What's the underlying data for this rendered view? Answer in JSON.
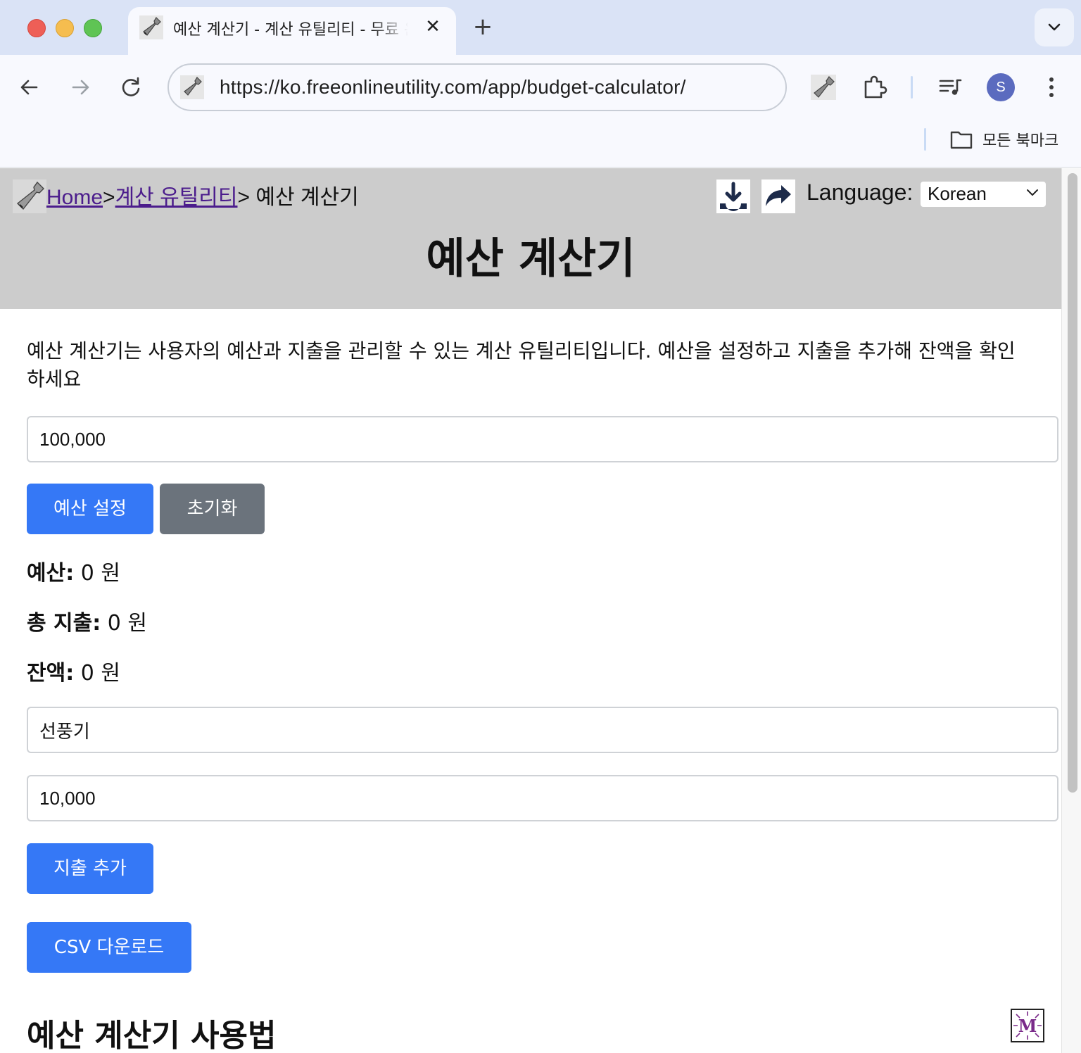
{
  "browser": {
    "tab": {
      "title": "예산 계산기 - 계산 유틸리티 - 무료 온라인 유틸리티",
      "favicon": "wrench-icon"
    },
    "new_tab_label": "+",
    "url": "https://ko.freeonlineutility.com/app/budget-calculator/",
    "profile_initial": "S",
    "bookmarks": {
      "all_bookmarks_label": "모든 북마크"
    }
  },
  "header": {
    "breadcrumb": {
      "home": "Home",
      "sep1": ">",
      "category": "계산 유틸리티",
      "sep2": ">",
      "current": " 예산 계산기"
    },
    "language_label": "Language:",
    "language_selected": "Korean",
    "title": "예산 계산기"
  },
  "main": {
    "description": "예산 계산기는 사용자의 예산과 지출을 관리할 수 있는 계산 유틸리티입니다. 예산을 설정하고 지출을 추가해 잔액을 확인하세요",
    "budget_input_value": "100,000",
    "set_budget_button": "예산 설정",
    "reset_button": "초기화",
    "stats": {
      "budget_label": "예산:",
      "budget_value": " 0 원",
      "total_expense_label": "총 지출:",
      "total_expense_value": " 0 원",
      "balance_label": "잔액:",
      "balance_value": " 0 원"
    },
    "expense_name_value": "선풍기",
    "expense_amount_value": "10,000",
    "add_expense_button": "지출 추가",
    "csv_button": "CSV 다운로드",
    "section_title": "예산 계산기 사용법",
    "badge_letter": "M"
  },
  "colors": {
    "primary_button": "#3578f6",
    "secondary_button": "#6b737c",
    "header_bg": "#cccccc",
    "link": "#4b1c8c",
    "tabbar_bg": "#dae3f6"
  }
}
